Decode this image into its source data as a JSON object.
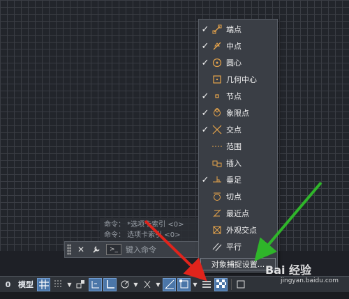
{
  "history": {
    "line1": "命令：  *选项卡索引 <0>",
    "line2": "命令：  选项卡索引 <0>"
  },
  "command_line": {
    "close_symbol": "✕",
    "settings_symbol": "🔧",
    "prompt_symbol": ">_",
    "placeholder": "键入命令"
  },
  "osnap_menu": {
    "items": [
      {
        "label": "端点",
        "checked": true,
        "icon": "endpoint-icon"
      },
      {
        "label": "中点",
        "checked": true,
        "icon": "midpoint-icon"
      },
      {
        "label": "圆心",
        "checked": true,
        "icon": "center-icon"
      },
      {
        "label": "几何中心",
        "checked": false,
        "icon": "geometric-center-icon"
      },
      {
        "label": "节点",
        "checked": true,
        "icon": "node-icon"
      },
      {
        "label": "象限点",
        "checked": true,
        "icon": "quadrant-icon"
      },
      {
        "label": "交点",
        "checked": true,
        "icon": "intersection-icon"
      },
      {
        "label": "范围",
        "checked": false,
        "icon": "extension-icon"
      },
      {
        "label": "插入",
        "checked": false,
        "icon": "insertion-icon"
      },
      {
        "label": "垂足",
        "checked": true,
        "icon": "perpendicular-icon"
      },
      {
        "label": "切点",
        "checked": false,
        "icon": "tangent-icon"
      },
      {
        "label": "最近点",
        "checked": false,
        "icon": "nearest-icon"
      },
      {
        "label": "外观交点",
        "checked": false,
        "icon": "apparent-intersection-icon"
      },
      {
        "label": "平行",
        "checked": false,
        "icon": "parallel-icon"
      }
    ],
    "check_mark": "✓",
    "settings_label": "对象捕捉设置..."
  },
  "statusbar": {
    "model_label": "模型",
    "left_edge": "0"
  },
  "watermark": {
    "main": "Bai 经验",
    "sub": "jingyan.baidu.com"
  },
  "colors": {
    "accent_orange": "#e8a54b",
    "active_blue": "#4b76a8",
    "arrow_red": "#e0241c",
    "arrow_green": "#2fb52a"
  }
}
